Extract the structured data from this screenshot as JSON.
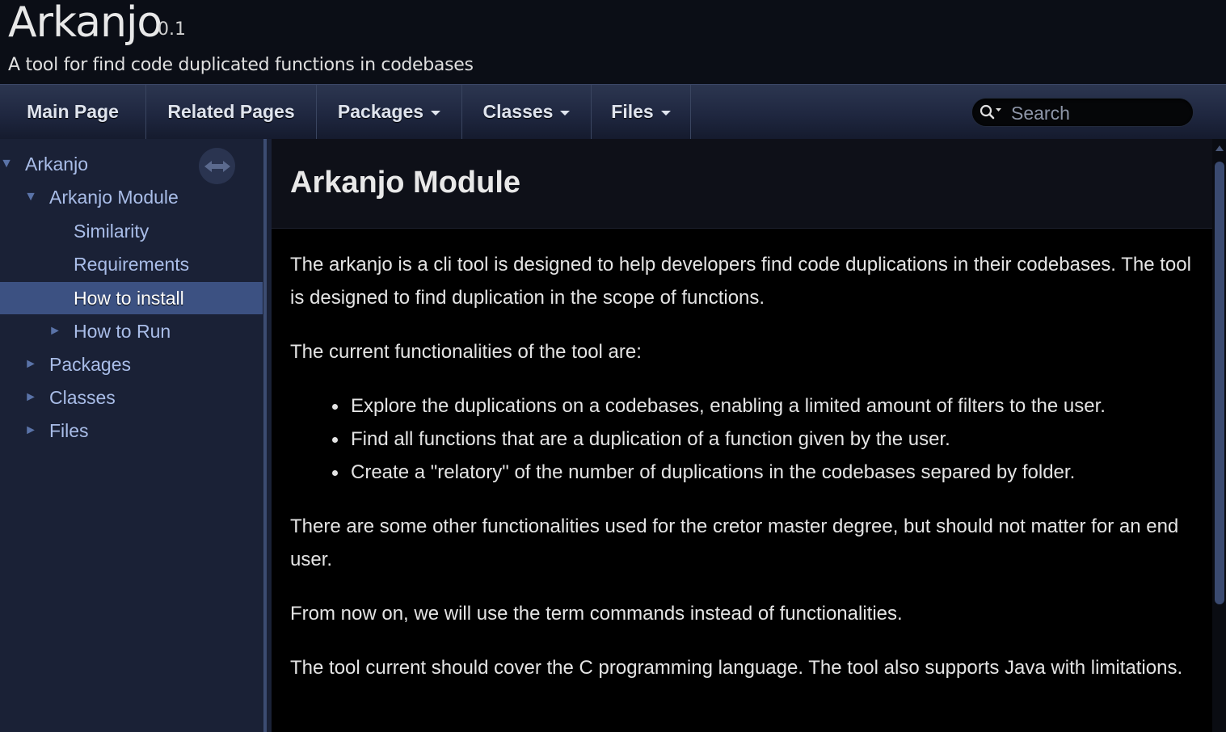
{
  "header": {
    "project_name": "Arkanjo",
    "project_number": "0.1",
    "project_brief": "A tool for find code duplicated functions in codebases"
  },
  "navbar": {
    "items": [
      {
        "label": "Main Page",
        "has_dropdown": false
      },
      {
        "label": "Related Pages",
        "has_dropdown": false
      },
      {
        "label": "Packages",
        "has_dropdown": true
      },
      {
        "label": "Classes",
        "has_dropdown": true
      },
      {
        "label": "Files",
        "has_dropdown": true
      }
    ],
    "search": {
      "placeholder": "Search",
      "icon": "search-icon"
    }
  },
  "sidenav": {
    "items": [
      {
        "label": "Arkanjo",
        "arrow": "▼",
        "level": 0
      },
      {
        "label": "Arkanjo Module",
        "arrow": "▼",
        "level": 1
      },
      {
        "label": "Similarity",
        "arrow": "",
        "level": 2
      },
      {
        "label": "Requirements",
        "arrow": "",
        "level": 2
      },
      {
        "label": "How to install",
        "arrow": "",
        "level": 2,
        "selected": true
      },
      {
        "label": "How to Run",
        "arrow": "►",
        "level": 2
      },
      {
        "label": "Packages",
        "arrow": "►",
        "level": 1
      },
      {
        "label": "Classes",
        "arrow": "►",
        "level": 1
      },
      {
        "label": "Files",
        "arrow": "►",
        "level": 1
      }
    ],
    "sync_icon": "sync-arrows-icon"
  },
  "content": {
    "title": "Arkanjo Module",
    "intro": "The arkanjo is a cli tool is designed to help developers find code duplications in their codebases. The tool is designed to find duplication in the scope of functions.",
    "functionalities_heading": "The current functionalities of the tool are:",
    "functionalities": [
      "Explore the duplications on a codebases, enabling a limited amount of filters to the user.",
      "Find all functions that are a duplication of a function given by the user.",
      "Create a \"relatory\" of the number of duplications in the codebases separed by folder."
    ],
    "other": "There are some other functionalities used for the cretor master degree, but should not matter for an end user.",
    "commands_note": "From now on, we will use the term commands instead of functionalities.",
    "languages": "The tool current should cover the C programming language. The tool also supports Java with limitations."
  },
  "colors": {
    "nav_bg": "#1f2740",
    "sidenav_bg": "#1a2136",
    "selected_bg": "#3c5182",
    "link": "#a9bde8",
    "content_bg": "#000000"
  }
}
